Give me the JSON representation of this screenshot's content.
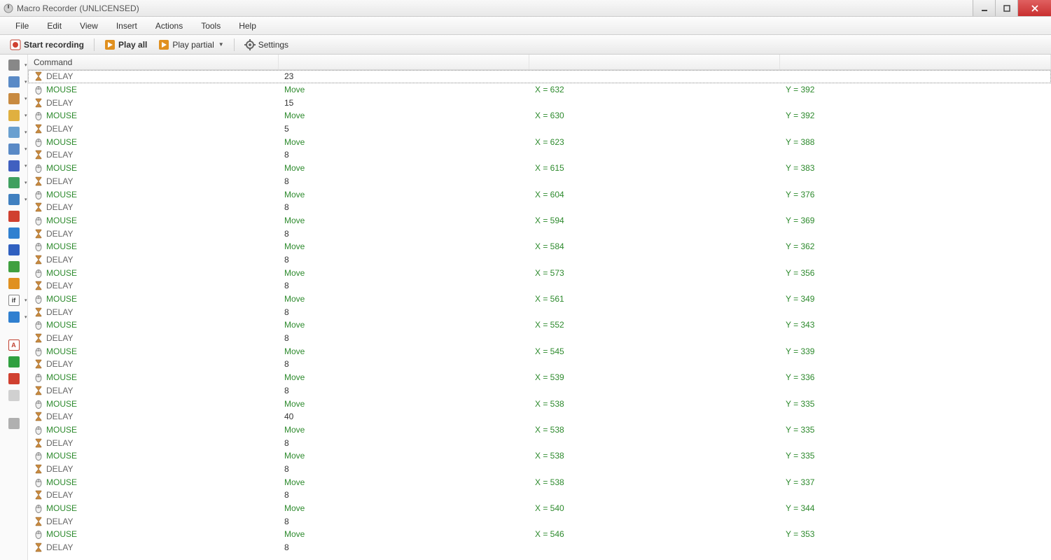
{
  "window": {
    "title": "Macro Recorder (UNLICENSED)"
  },
  "menu": [
    "File",
    "Edit",
    "View",
    "Insert",
    "Actions",
    "Tools",
    "Help"
  ],
  "toolbar": {
    "start_recording": "Start recording",
    "play_all": "Play all",
    "play_partial": "Play partial",
    "settings": "Settings"
  },
  "table": {
    "header": "Command",
    "rows": [
      {
        "type": "delay",
        "cmd": "DELAY",
        "v1": "23",
        "v2": "",
        "v3": "",
        "selected": true
      },
      {
        "type": "mouse",
        "cmd": "MOUSE",
        "v1": "Move",
        "v2": "X = 632",
        "v3": "Y = 392"
      },
      {
        "type": "delay",
        "cmd": "DELAY",
        "v1": "15",
        "v2": "",
        "v3": ""
      },
      {
        "type": "mouse",
        "cmd": "MOUSE",
        "v1": "Move",
        "v2": "X = 630",
        "v3": "Y = 392"
      },
      {
        "type": "delay",
        "cmd": "DELAY",
        "v1": "5",
        "v2": "",
        "v3": ""
      },
      {
        "type": "mouse",
        "cmd": "MOUSE",
        "v1": "Move",
        "v2": "X = 623",
        "v3": "Y = 388"
      },
      {
        "type": "delay",
        "cmd": "DELAY",
        "v1": "8",
        "v2": "",
        "v3": ""
      },
      {
        "type": "mouse",
        "cmd": "MOUSE",
        "v1": "Move",
        "v2": "X = 615",
        "v3": "Y = 383"
      },
      {
        "type": "delay",
        "cmd": "DELAY",
        "v1": "8",
        "v2": "",
        "v3": ""
      },
      {
        "type": "mouse",
        "cmd": "MOUSE",
        "v1": "Move",
        "v2": "X = 604",
        "v3": "Y = 376"
      },
      {
        "type": "delay",
        "cmd": "DELAY",
        "v1": "8",
        "v2": "",
        "v3": ""
      },
      {
        "type": "mouse",
        "cmd": "MOUSE",
        "v1": "Move",
        "v2": "X = 594",
        "v3": "Y = 369"
      },
      {
        "type": "delay",
        "cmd": "DELAY",
        "v1": "8",
        "v2": "",
        "v3": ""
      },
      {
        "type": "mouse",
        "cmd": "MOUSE",
        "v1": "Move",
        "v2": "X = 584",
        "v3": "Y = 362"
      },
      {
        "type": "delay",
        "cmd": "DELAY",
        "v1": "8",
        "v2": "",
        "v3": ""
      },
      {
        "type": "mouse",
        "cmd": "MOUSE",
        "v1": "Move",
        "v2": "X = 573",
        "v3": "Y = 356"
      },
      {
        "type": "delay",
        "cmd": "DELAY",
        "v1": "8",
        "v2": "",
        "v3": ""
      },
      {
        "type": "mouse",
        "cmd": "MOUSE",
        "v1": "Move",
        "v2": "X = 561",
        "v3": "Y = 349"
      },
      {
        "type": "delay",
        "cmd": "DELAY",
        "v1": "8",
        "v2": "",
        "v3": ""
      },
      {
        "type": "mouse",
        "cmd": "MOUSE",
        "v1": "Move",
        "v2": "X = 552",
        "v3": "Y = 343"
      },
      {
        "type": "delay",
        "cmd": "DELAY",
        "v1": "8",
        "v2": "",
        "v3": ""
      },
      {
        "type": "mouse",
        "cmd": "MOUSE",
        "v1": "Move",
        "v2": "X = 545",
        "v3": "Y = 339"
      },
      {
        "type": "delay",
        "cmd": "DELAY",
        "v1": "8",
        "v2": "",
        "v3": ""
      },
      {
        "type": "mouse",
        "cmd": "MOUSE",
        "v1": "Move",
        "v2": "X = 539",
        "v3": "Y = 336"
      },
      {
        "type": "delay",
        "cmd": "DELAY",
        "v1": "8",
        "v2": "",
        "v3": ""
      },
      {
        "type": "mouse",
        "cmd": "MOUSE",
        "v1": "Move",
        "v2": "X = 538",
        "v3": "Y = 335"
      },
      {
        "type": "delay",
        "cmd": "DELAY",
        "v1": "40",
        "v2": "",
        "v3": ""
      },
      {
        "type": "mouse",
        "cmd": "MOUSE",
        "v1": "Move",
        "v2": "X = 538",
        "v3": "Y = 335"
      },
      {
        "type": "delay",
        "cmd": "DELAY",
        "v1": "8",
        "v2": "",
        "v3": ""
      },
      {
        "type": "mouse",
        "cmd": "MOUSE",
        "v1": "Move",
        "v2": "X = 538",
        "v3": "Y = 335"
      },
      {
        "type": "delay",
        "cmd": "DELAY",
        "v1": "8",
        "v2": "",
        "v3": ""
      },
      {
        "type": "mouse",
        "cmd": "MOUSE",
        "v1": "Move",
        "v2": "X = 538",
        "v3": "Y = 337"
      },
      {
        "type": "delay",
        "cmd": "DELAY",
        "v1": "8",
        "v2": "",
        "v3": ""
      },
      {
        "type": "mouse",
        "cmd": "MOUSE",
        "v1": "Move",
        "v2": "X = 540",
        "v3": "Y = 344"
      },
      {
        "type": "delay",
        "cmd": "DELAY",
        "v1": "8",
        "v2": "",
        "v3": ""
      },
      {
        "type": "mouse",
        "cmd": "MOUSE",
        "v1": "Move",
        "v2": "X = 546",
        "v3": "Y = 353"
      },
      {
        "type": "delay",
        "cmd": "DELAY",
        "v1": "8",
        "v2": "",
        "v3": ""
      }
    ]
  },
  "sidebar_tools": [
    {
      "name": "mouse-tool-icon",
      "arrow": true,
      "color": "#888"
    },
    {
      "name": "keyboard-tool-icon",
      "arrow": true,
      "color": "#5a8ac6"
    },
    {
      "name": "delay-tool-icon",
      "arrow": true,
      "color": "#c88a40"
    },
    {
      "name": "open-file-tool-icon",
      "arrow": true,
      "color": "#e0b040"
    },
    {
      "name": "window-tool-icon",
      "arrow": true,
      "color": "#6aa0d0"
    },
    {
      "name": "clipboard-tool-icon",
      "arrow": true,
      "color": "#5a8ac6"
    },
    {
      "name": "text-tool-icon",
      "arrow": true,
      "color": "#4060c0"
    },
    {
      "name": "color-picker-tool-icon",
      "arrow": true,
      "color": "#40a060"
    },
    {
      "name": "image-tool-icon",
      "arrow": true,
      "color": "#4080c0"
    },
    {
      "name": "shutdown-tool-icon",
      "arrow": false,
      "color": "#d04030"
    },
    {
      "name": "web-tool-icon",
      "arrow": false,
      "color": "#3080d0"
    },
    {
      "name": "info-tool-icon",
      "arrow": false,
      "color": "#3060c0"
    },
    {
      "name": "network-tool-icon",
      "arrow": false,
      "color": "#40a040"
    },
    {
      "name": "play-tool-icon",
      "arrow": false,
      "color": "#e09020"
    },
    {
      "name": "if-tool-icon",
      "arrow": true,
      "color": "#ffffff",
      "text": "if"
    },
    {
      "name": "loop-tool-icon",
      "arrow": true,
      "color": "#3080d0"
    },
    {
      "gap": true
    },
    {
      "name": "label-tool-icon",
      "arrow": false,
      "color": "#ffffff",
      "text": "A",
      "border": true
    },
    {
      "name": "goto-tool-icon",
      "arrow": false,
      "color": "#30a040"
    },
    {
      "name": "stop-tool-icon",
      "arrow": false,
      "color": "#d04030"
    },
    {
      "name": "comment-tool-icon",
      "arrow": false,
      "color": "#d0d0d0"
    },
    {
      "gap": true
    },
    {
      "name": "macro-tool-icon",
      "arrow": false,
      "color": "#b0b0b0"
    }
  ]
}
